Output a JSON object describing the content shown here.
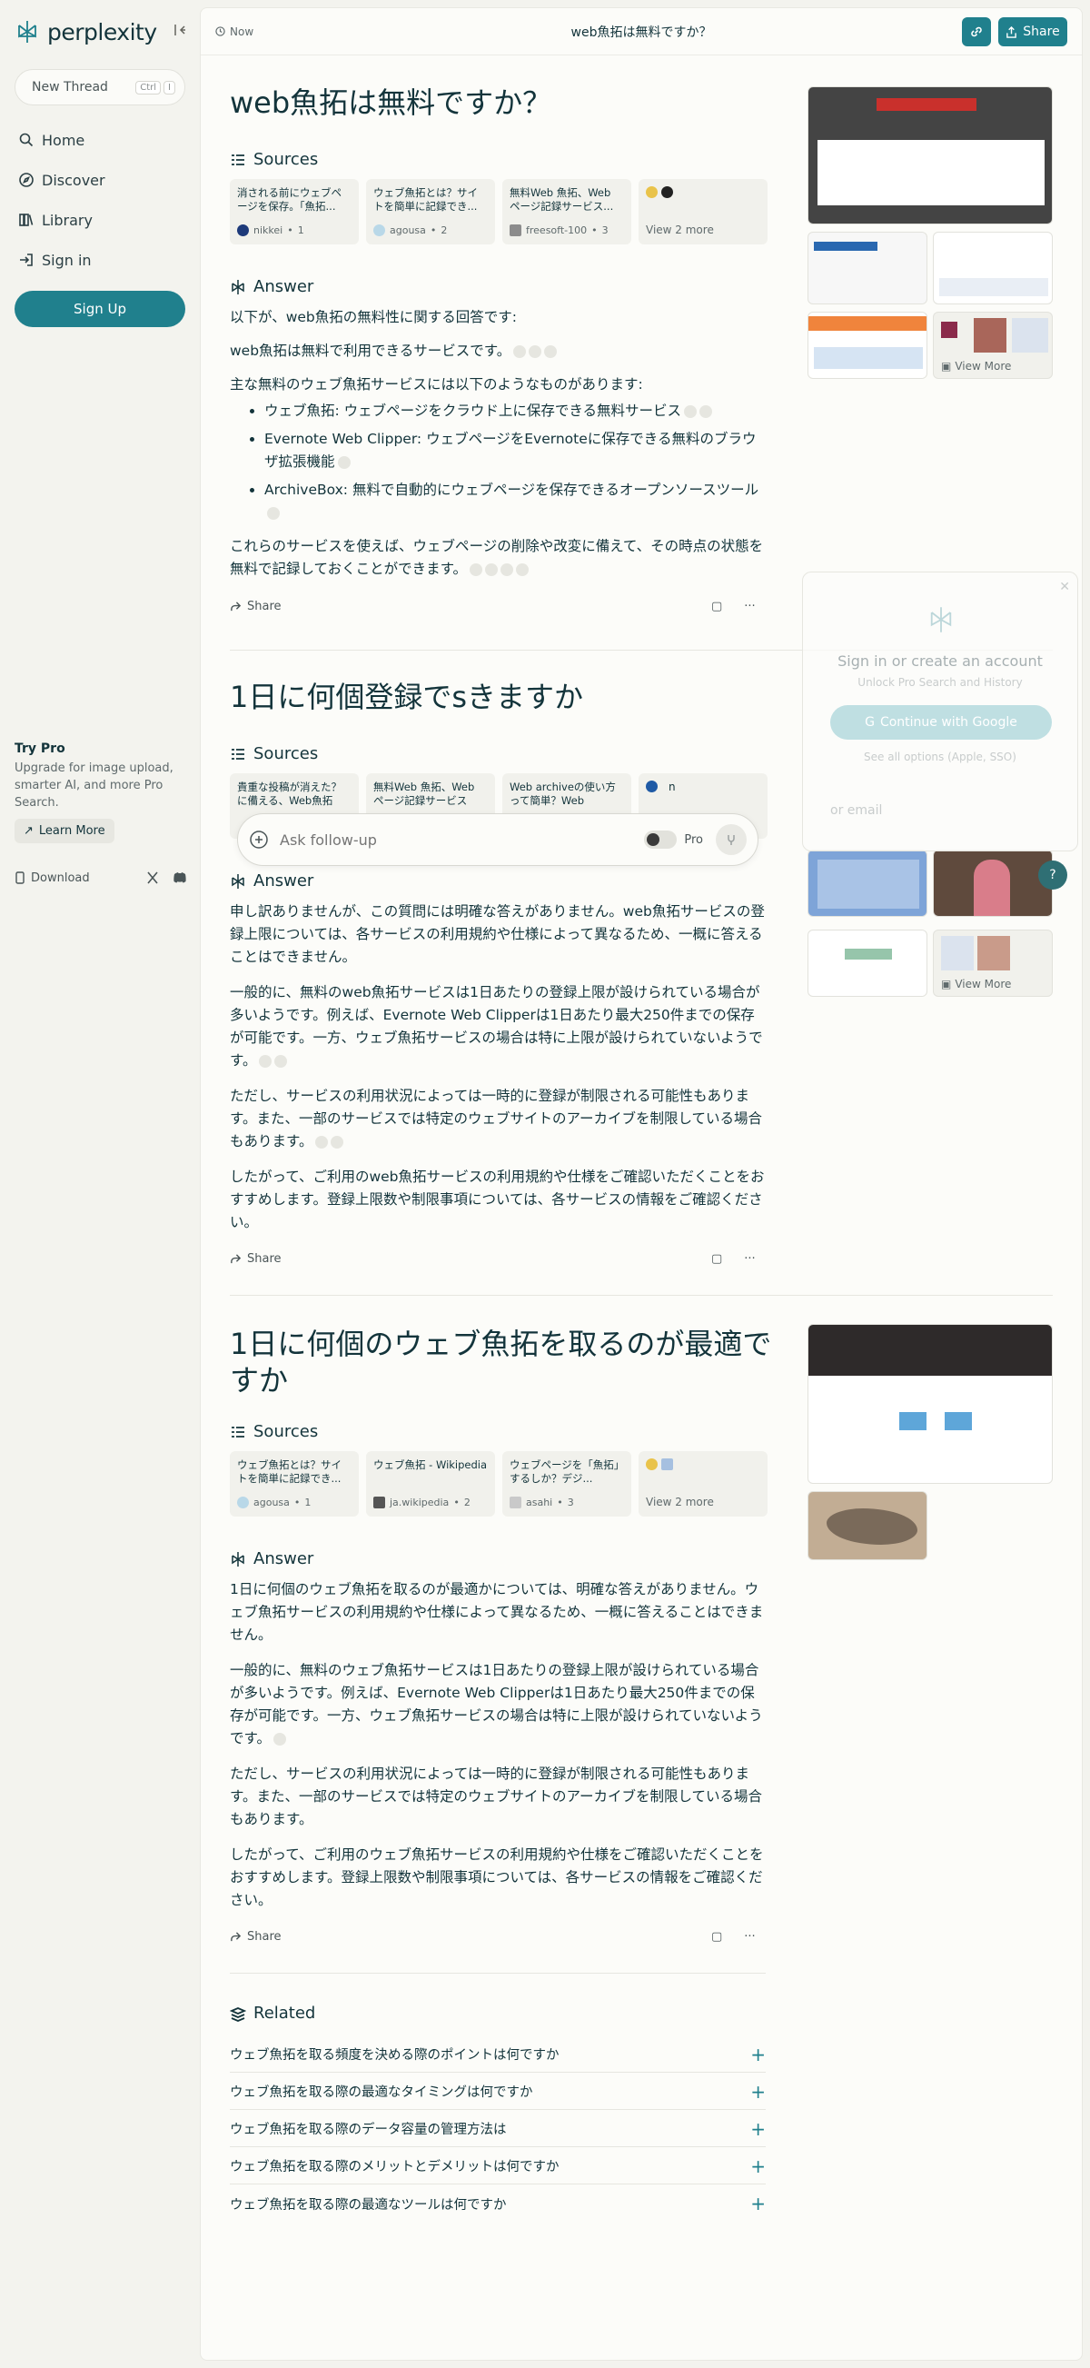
{
  "sidebar": {
    "logo": "perplexity",
    "new_thread": "New Thread",
    "kbd": [
      "Ctrl",
      "I"
    ],
    "nav": [
      {
        "label": "Home",
        "icon": "search-icon"
      },
      {
        "label": "Discover",
        "icon": "compass-icon"
      },
      {
        "label": "Library",
        "icon": "library-icon"
      },
      {
        "label": "Sign in",
        "icon": "sign-in-icon"
      }
    ],
    "signup": "Sign Up",
    "try_pro": {
      "title": "Try Pro",
      "desc": "Upgrade for image upload, smarter AI, and more Pro Search.",
      "learn": "Learn More"
    },
    "download": "Download"
  },
  "topbar": {
    "time": "Now",
    "title": "web魚拓は無料ですか？",
    "share": "Share"
  },
  "threads": [
    {
      "title": "web魚拓は無料ですか？",
      "sources_label": "Sources",
      "sources": [
        {
          "title": "消される前にウェブページを保存。「魚拓...",
          "site": "nikkei",
          "n": "1",
          "color": "#1d3a7a"
        },
        {
          "title": "ウェブ魚拓とは？サイトを簡単に記録でき...",
          "site": "agousa",
          "n": "2",
          "color": "#b9d8e8"
        },
        {
          "title": "無料Web 魚拓、Web ページ記録サービス...",
          "site": "freesoft-100",
          "n": "3",
          "color": "#8c8c8c"
        }
      ],
      "more": "View 2 more",
      "answer_label": "Answer",
      "answer": {
        "p1": "以下が、web魚拓の無料性に関する回答です:",
        "p2": "web魚拓は無料で利用できるサービスです。",
        "p3": "主な無料のウェブ魚拓サービスには以下のようなものがあります:",
        "list": [
          "ウェブ魚拓: ウェブページをクラウド上に保存できる無料サービス",
          "Evernote Web Clipper: ウェブページをEvernoteに保存できる無料のブラウザ拡張機能",
          "ArchiveBox: 無料で自動的にウェブページを保存できるオープンソースツール"
        ],
        "p4": "これらのサービスを使えば、ウェブページの削除や改変に備えて、その時点の状態を無料で記録しておくことができます。"
      },
      "share": "Share",
      "view_more": "View More"
    },
    {
      "title": "1日に何個登録でsきますか",
      "sources_label": "Sources",
      "sources": [
        {
          "title": "貴重な投稿が消えた？に備える、Web魚拓",
          "site": "",
          "n": "",
          "color": ""
        },
        {
          "title": "無料Web 魚拓、Web ページ記録サービス",
          "site": "",
          "n": "",
          "color": ""
        },
        {
          "title": "Web archiveの使い方って簡単？Web",
          "site": "",
          "n": "",
          "color": ""
        }
      ],
      "more_letter": "n",
      "answer_label": "Answer",
      "paras": [
        "申し訳ありませんが、この質問には明確な答えがありません。web魚拓サービスの登録上限については、各サービスの利用規約や仕様によって異なるため、一概に答えることはできません。",
        "一般的に、無料のweb魚拓サービスは1日あたりの登録上限が設けられている場合が多いようです。例えば、Evernote Web Clipperは1日あたり最大250件までの保存が可能です。一方、ウェブ魚拓サービスの場合は特に上限が設けられていないようです。",
        "ただし、サービスの利用状況によっては一時的に登録が制限される可能性もあります。また、一部のサービスでは特定のウェブサイトのアーカイブを制限している場合もあります。",
        "したがって、ご利用のweb魚拓サービスの利用規約や仕様をご確認いただくことをおすすめします。登録上限数や制限事項については、各サービスの情報をご確認ください。"
      ],
      "share": "Share",
      "view_more": "View More"
    },
    {
      "title": "1日に何個のウェブ魚拓を取るのが最適ですか",
      "sources_label": "Sources",
      "sources": [
        {
          "title": "ウェブ魚拓とは？サイトを簡単に記録でき...",
          "site": "agousa",
          "n": "1",
          "color": "#b9d8e8"
        },
        {
          "title": "ウェブ魚拓 - Wikipedia",
          "site": "ja.wikipedia",
          "n": "2",
          "color": "#555555"
        },
        {
          "title": "ウェブページを「魚拓」するしか？デジ...",
          "site": "asahi",
          "n": "3",
          "color": "#c9c9c9"
        }
      ],
      "more": "View 2 more",
      "answer_label": "Answer",
      "paras": [
        "1日に何個のウェブ魚拓を取るのが最適かについては、明確な答えがありません。ウェブ魚拓サービスの利用規約や仕様によって異なるため、一概に答えることはできません。",
        "一般的に、無料のウェブ魚拓サービスは1日あたりの登録上限が設けられている場合が多いようです。例えば、Evernote Web Clipperは1日あたり最大250件までの保存が可能です。一方、ウェブ魚拓サービスの場合は特に上限が設けられていないようです。",
        "ただし、サービスの利用状況によっては一時的に登録が制限される可能性もあります。また、一部のサービスでは特定のウェブサイトのアーカイブを制限している場合もあります。",
        "したがって、ご利用のウェブ魚拓サービスの利用規約や仕様をご確認いただくことをおすすめします。登録上限数や制限事項については、各サービスの情報をご確認ください。"
      ],
      "share": "Share"
    }
  ],
  "followup": {
    "placeholder": "Ask follow-up",
    "pro": "Pro"
  },
  "signin": {
    "title": "Sign in or create an account",
    "sub": "Unlock Pro Search and History",
    "google": "Continue with Google",
    "options": "See all options (Apple, SSO)",
    "email": "or email"
  },
  "related": {
    "label": "Related",
    "items": [
      "ウェブ魚拓を取る頻度を決める際のポイントは何ですか",
      "ウェブ魚拓を取る際の最適なタイミングは何ですか",
      "ウェブ魚拓を取る際のデータ容量の管理方法は",
      "ウェブ魚拓を取る際のメリットとデメリットは何ですか",
      "ウェブ魚拓を取る際の最適なツールは何ですか"
    ]
  },
  "colors": {
    "accent": "#20808d",
    "bg": "#f3f3ee",
    "panel": "#fcfcf9"
  }
}
